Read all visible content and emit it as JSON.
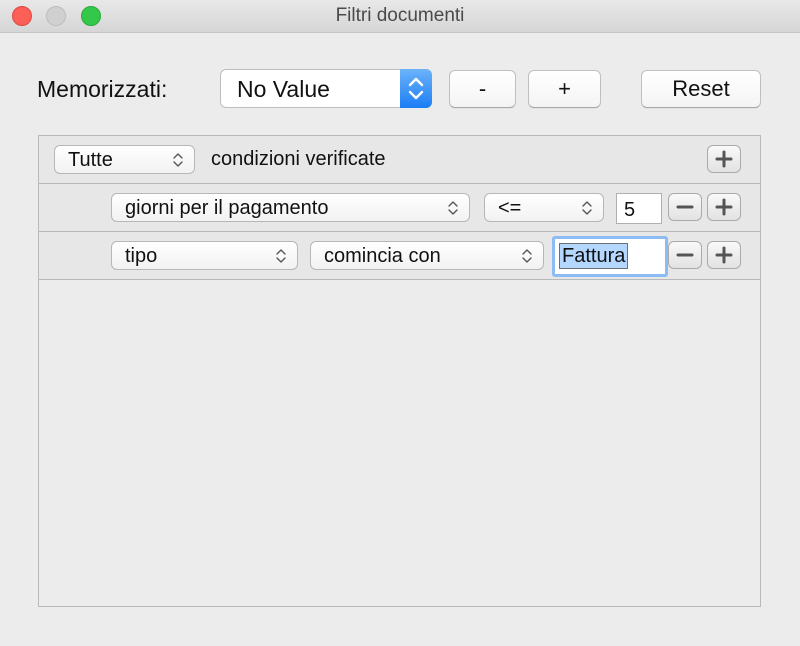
{
  "window": {
    "title": "Filtri documenti"
  },
  "toolbar": {
    "saved_label": "Memorizzati:",
    "saved_value": "No Value",
    "minus_label": "-",
    "plus_label": "+",
    "reset_label": "Reset"
  },
  "predicate": {
    "header": {
      "match": "Tutte",
      "text": "condizioni verificate"
    },
    "rows": [
      {
        "field": "giorni per il pagamento",
        "operator": "<=",
        "value": "5"
      },
      {
        "field": "tipo",
        "operator": "comincia con",
        "value": "Fattura"
      }
    ]
  },
  "colors": {
    "accent": "#1b7ef5",
    "selection": "#b3d7ff",
    "focus_ring": "#8cbcf3"
  },
  "icons": [
    "close-icon",
    "minimize-icon",
    "zoom-icon",
    "up-down-arrows-icon",
    "plus-icon",
    "minus-icon"
  ]
}
